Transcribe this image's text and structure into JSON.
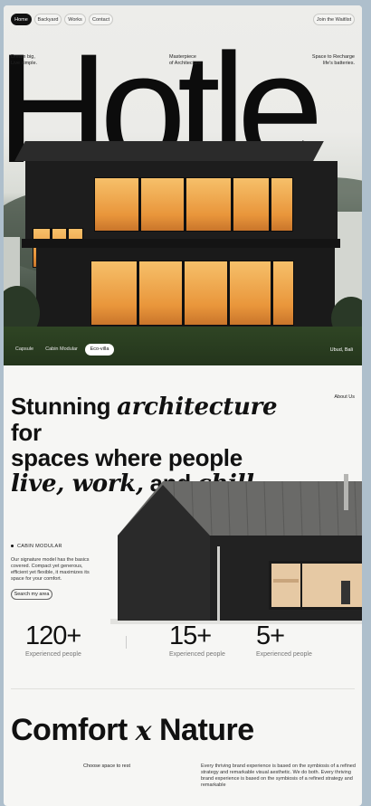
{
  "nav": {
    "items": [
      "Home",
      "Backyard",
      "Works",
      "Contact"
    ],
    "cta": "Join the Waitlist"
  },
  "hero": {
    "tagline_left": "Dream big,\nLive simple.",
    "tagline_center": "Masterpiece\nof Architecture",
    "tagline_right": "Space to Recharge\nlife's batteries.",
    "title": "Hotle",
    "tabs": [
      "Capsule",
      "Cabin Modular",
      "Eco-villa"
    ],
    "active_tab": "Eco-villa",
    "location": "Ubud, Bali"
  },
  "intro": {
    "about_link": "About Us",
    "headline_1": "Stunning ",
    "headline_1_italic": "architecture",
    "headline_2": " for",
    "headline_3": "spaces where people",
    "headline_4_italic": "live, work,",
    "headline_5": " and ",
    "headline_6_italic": "chill."
  },
  "feature": {
    "label": "CABIN MODULAR",
    "text": "Our signature model has the basics covered. Compact yet generous, efficient yet flexible, it maximizes its space for your comfort.",
    "button": "Search my area"
  },
  "stats": [
    {
      "value": "120+",
      "label": "Experienced people"
    },
    {
      "value": "15+",
      "label": "Experienced people"
    },
    {
      "value": "5+",
      "label": "Experienced people"
    }
  ],
  "comfort": {
    "title_left": "Comfort ",
    "title_x": "x",
    "title_right": " Nature",
    "choose": "Choose space to rest",
    "paragraph": "Every thriving brand experience is based on the symbiosis of a refined strategy and remarkable visual aesthetic. We do both. Every thriving brand experience is based on the symbiosis of a refined strategy and remarkable"
  },
  "colors": {
    "background": "#aebfcc",
    "page": "#f6f6f4",
    "accent": "#111111",
    "window_glow": "#f0a94d"
  }
}
